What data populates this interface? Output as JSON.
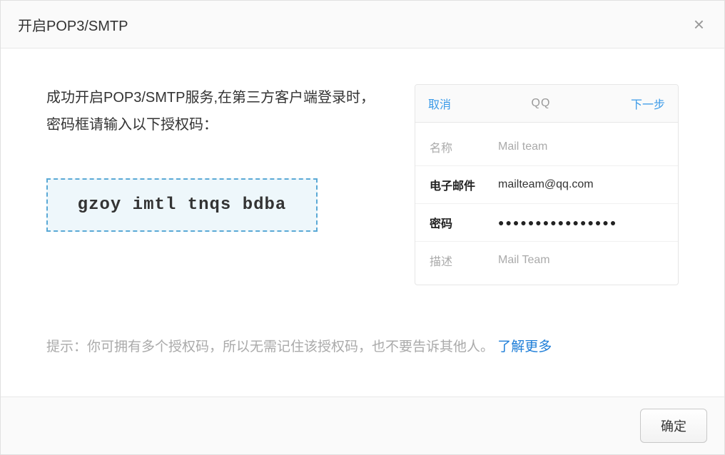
{
  "header": {
    "title": "开启POP3/SMTP"
  },
  "body": {
    "description": "成功开启POP3/SMTP服务,在第三方客户端登录时，密码框请输入以下授权码：",
    "auth_code": "gzoy imtl tnqs bdba",
    "preview": {
      "cancel": "取消",
      "title": "QQ",
      "next": "下一步",
      "rows": {
        "name_label": "名称",
        "name_value": "Mail team",
        "email_label": "电子邮件",
        "email_value": "mailteam@qq.com",
        "password_label": "密码",
        "password_value": "●●●●●●●●●●●●●●●●",
        "desc_label": "描述",
        "desc_value": "Mail Team"
      }
    },
    "hint_prefix": "提示：你可拥有多个授权码，所以无需记住该授权码，也不要告诉其他人。",
    "hint_link": "了解更多"
  },
  "footer": {
    "confirm": "确定"
  }
}
